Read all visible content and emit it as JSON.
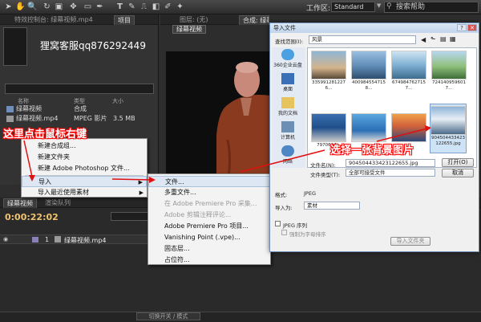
{
  "toolbar": {
    "workspace_label": "工作区:",
    "workspace_value": "Standard",
    "search_placeholder": "搜索帮助"
  },
  "panels": {
    "effects_tab": "特效控制台: 绿幕视频.mp4",
    "project_tab": "项目",
    "composition_tab": "合成: 绿幕视频",
    "layer_tab": "图层: (无)",
    "composition_button": "绿幕视频"
  },
  "watermark": "狸窝客服qq876292449",
  "project": {
    "columns": [
      "名称",
      "类型",
      "大小"
    ],
    "items": [
      {
        "name": "绿幕视频",
        "type": "合成",
        "size": ""
      },
      {
        "name": "绿幕视频.mp4",
        "type": "MPEG 影片",
        "size": "3.5 MB"
      }
    ]
  },
  "timeline": {
    "tabs": [
      "绿幕视频",
      "渲染队列"
    ],
    "timecode": "0:00:22:02",
    "layer_number": "1",
    "layer_name": "绿幕视频.mp4",
    "switch_label": "切换开关 / 模式"
  },
  "context_menu": {
    "items": [
      "新建合成组...",
      "新建文件夹",
      "新建 Adobe Photoshop 文件...",
      "导入",
      "导入最近使用素材"
    ]
  },
  "import_submenu": {
    "items": [
      {
        "label": "文件...",
        "enabled": true
      },
      {
        "label": "多重文件...",
        "enabled": true
      },
      {
        "label": "在 Adobe Premiere Pro 采集...",
        "enabled": false
      },
      {
        "label": "Adobe 剪辑注释评论...",
        "enabled": false
      },
      {
        "label": "Adobe Premiere Pro 项目...",
        "enabled": true
      },
      {
        "label": "Vanishing Point (.vpe)...",
        "enabled": true
      },
      {
        "label": "固态层...",
        "enabled": true
      },
      {
        "label": "占位符...",
        "enabled": true
      }
    ]
  },
  "annotations": {
    "right_click": "这里点击鼠标右键",
    "choose_bg": "选择一张背景图片"
  },
  "dialog": {
    "title": "导入文件",
    "look_in_label": "查找范围(I):",
    "look_in_value": "风景",
    "nav": [
      "360企业云盘",
      "桌面",
      "我的文档",
      "计算机",
      "网络"
    ],
    "files": [
      {
        "name": "3359912812276..."
      },
      {
        "name": "4009845547158..."
      },
      {
        "name": "6749847627157..."
      },
      {
        "name": "7241409596017..."
      },
      {
        "name": "7970634..."
      },
      {
        "name": ""
      },
      {
        "name": ""
      },
      {
        "name": "904504433423122655.jpg"
      }
    ],
    "filename_label": "文件名(N):",
    "filename_value": "904504433423122655.jpg",
    "filetype_label": "文件类型(T):",
    "filetype_value": "全部可接受文件",
    "open_button": "打开(O)",
    "cancel_button": "取消",
    "format_label": "格式:",
    "format_value": "JPEG",
    "import_as_label": "导入为:",
    "import_as_value": "素材",
    "jpeg_sequence": "JPEG 序列",
    "alpha_order": "强制为字母排序",
    "import_folder_button": "导入文件夹"
  }
}
